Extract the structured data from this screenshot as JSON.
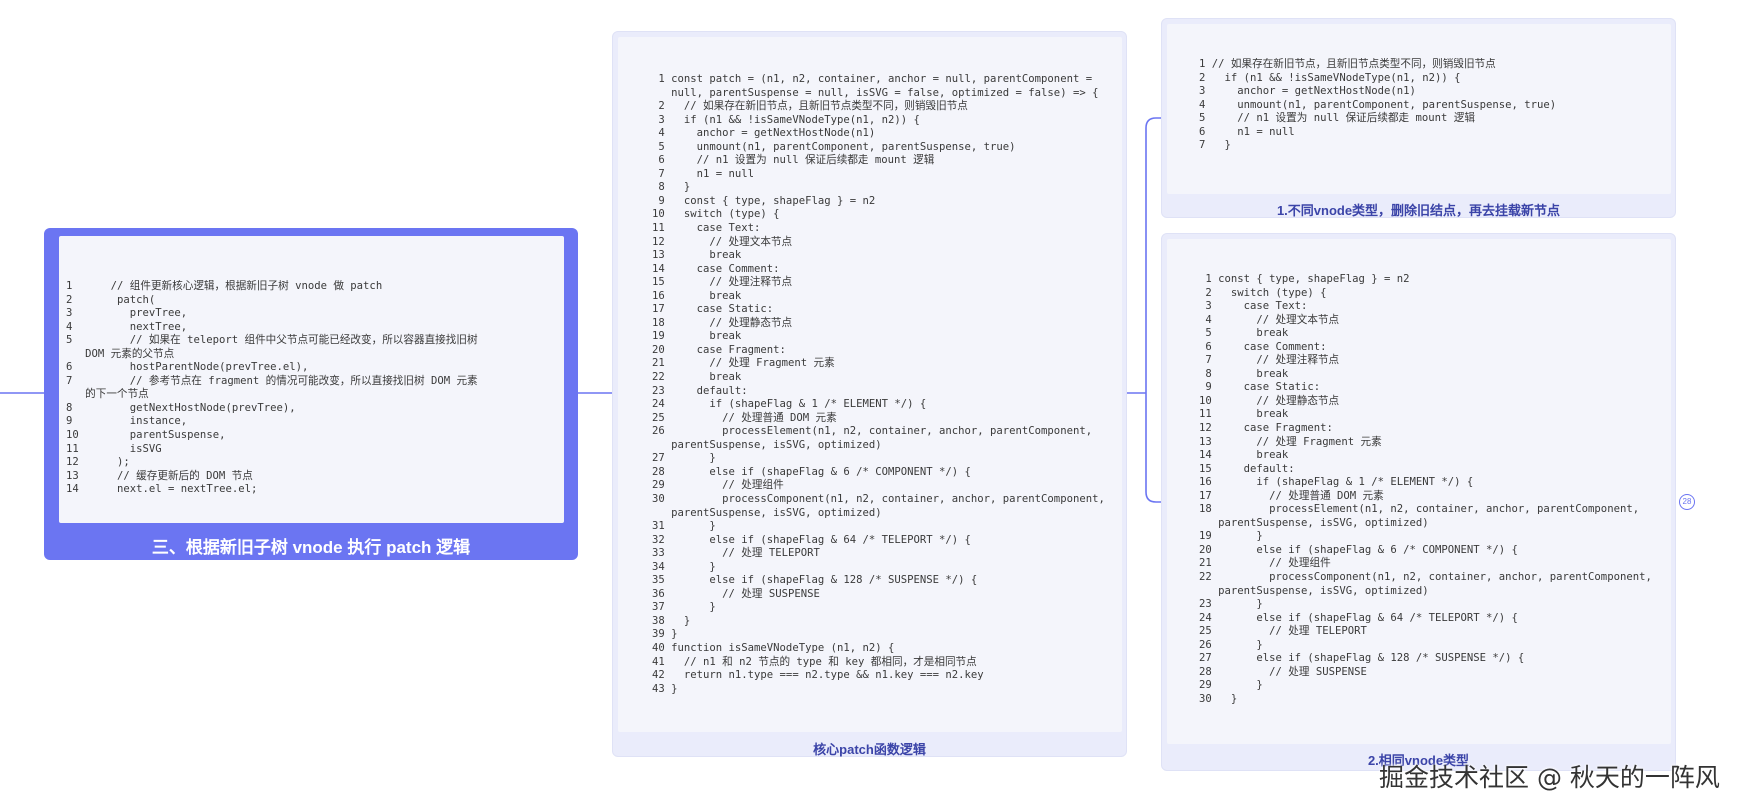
{
  "main_node": {
    "caption": "三、根据新旧子树 vnode 执行 patch 逻辑",
    "code": [
      "1      // 组件更新核心逻辑，根据新旧子树 vnode 做 patch",
      "2       patch(",
      "3         prevTree,",
      "4         nextTree,",
      "5         // 如果在 teleport 组件中父节点可能已经改变，所以容器直接找旧树",
      "   DOM 元素的父节点",
      "6         hostParentNode(prevTree.el),",
      "7         // 参考节点在 fragment 的情况可能改变，所以直接找旧树 DOM 元素",
      "   的下一个节点",
      "8         getNextHostNode(prevTree),",
      "9         instance,",
      "10        parentSuspense,",
      "11        isSVG",
      "12      );",
      "13      // 缓存更新后的 DOM 节点",
      "14      next.el = nextTree.el;"
    ]
  },
  "core_node": {
    "caption": "核心patch函数逻辑",
    "code": [
      " 1 const patch = (n1, n2, container, anchor = null, parentComponent =",
      "   null, parentSuspense = null, isSVG = false, optimized = false) => {",
      " 2   // 如果存在新旧节点，且新旧节点类型不同，则销毁旧节点",
      " 3   if (n1 && !isSameVNodeType(n1, n2)) {",
      " 4     anchor = getNextHostNode(n1)",
      " 5     unmount(n1, parentComponent, parentSuspense, true)",
      " 6     // n1 设置为 null 保证后续都走 mount 逻辑",
      " 7     n1 = null",
      " 8   }",
      " 9   const { type, shapeFlag } = n2",
      "10   switch (type) {",
      "11     case Text:",
      "12       // 处理文本节点",
      "13       break",
      "14     case Comment:",
      "15       // 处理注释节点",
      "16       break",
      "17     case Static:",
      "18       // 处理静态节点",
      "19       break",
      "20     case Fragment:",
      "21       // 处理 Fragment 元素",
      "22       break",
      "23     default:",
      "24       if (shapeFlag & 1 /* ELEMENT */) {",
      "25         // 处理普通 DOM 元素",
      "26         processElement(n1, n2, container, anchor, parentComponent,",
      "   parentSuspense, isSVG, optimized)",
      "27       }",
      "28       else if (shapeFlag & 6 /* COMPONENT */) {",
      "29         // 处理组件",
      "30         processComponent(n1, n2, container, anchor, parentComponent,",
      "   parentSuspense, isSVG, optimized)",
      "31       }",
      "32       else if (shapeFlag & 64 /* TELEPORT */) {",
      "33         // 处理 TELEPORT",
      "34       }",
      "35       else if (shapeFlag & 128 /* SUSPENSE */) {",
      "36         // 处理 SUSPENSE",
      "37       }",
      "38   }",
      "39 }",
      "40 function isSameVNodeType (n1, n2) {",
      "41   // n1 和 n2 节点的 type 和 key 都相同，才是相同节点",
      "42   return n1.type === n2.type && n1.key === n2.key",
      "43 }"
    ]
  },
  "branch_1": {
    "caption": "1.不同vnode类型，删除旧结点，再去挂载新节点",
    "code": [
      "1 // 如果存在新旧节点，且新旧节点类型不同，则销毁旧节点",
      "2   if (n1 && !isSameVNodeType(n1, n2)) {",
      "3     anchor = getNextHostNode(n1)",
      "4     unmount(n1, parentComponent, parentSuspense, true)",
      "5     // n1 设置为 null 保证后续都走 mount 逻辑",
      "6     n1 = null",
      "7   }"
    ]
  },
  "branch_2": {
    "caption": "2.相同vnode类型",
    "code": [
      " 1 const { type, shapeFlag } = n2",
      " 2   switch (type) {",
      " 3     case Text:",
      " 4       // 处理文本节点",
      " 5       break",
      " 6     case Comment:",
      " 7       // 处理注释节点",
      " 8       break",
      " 9     case Static:",
      "10       // 处理静态节点",
      "11       break",
      "12     case Fragment:",
      "13       // 处理 Fragment 元素",
      "14       break",
      "15     default:",
      "16       if (shapeFlag & 1 /* ELEMENT */) {",
      "17         // 处理普通 DOM 元素",
      "18         processElement(n1, n2, container, anchor, parentComponent,",
      "   parentSuspense, isSVG, optimized)",
      "19       }",
      "20       else if (shapeFlag & 6 /* COMPONENT */) {",
      "21         // 处理组件",
      "22         processComponent(n1, n2, container, anchor, parentComponent,",
      "   parentSuspense, isSVG, optimized)",
      "23       }",
      "24       else if (shapeFlag & 64 /* TELEPORT */) {",
      "25         // 处理 TELEPORT",
      "26       }",
      "27       else if (shapeFlag & 128 /* SUSPENSE */) {",
      "28         // 处理 SUSPENSE",
      "29       }",
      "30   }"
    ]
  },
  "collapse_badge": "28",
  "watermark": "掘金技术社区 @ 秋天的一阵风",
  "colors": {
    "main_node": "#6b75f2",
    "sub_node": "#eaecfb",
    "link": "#6b75f2"
  }
}
